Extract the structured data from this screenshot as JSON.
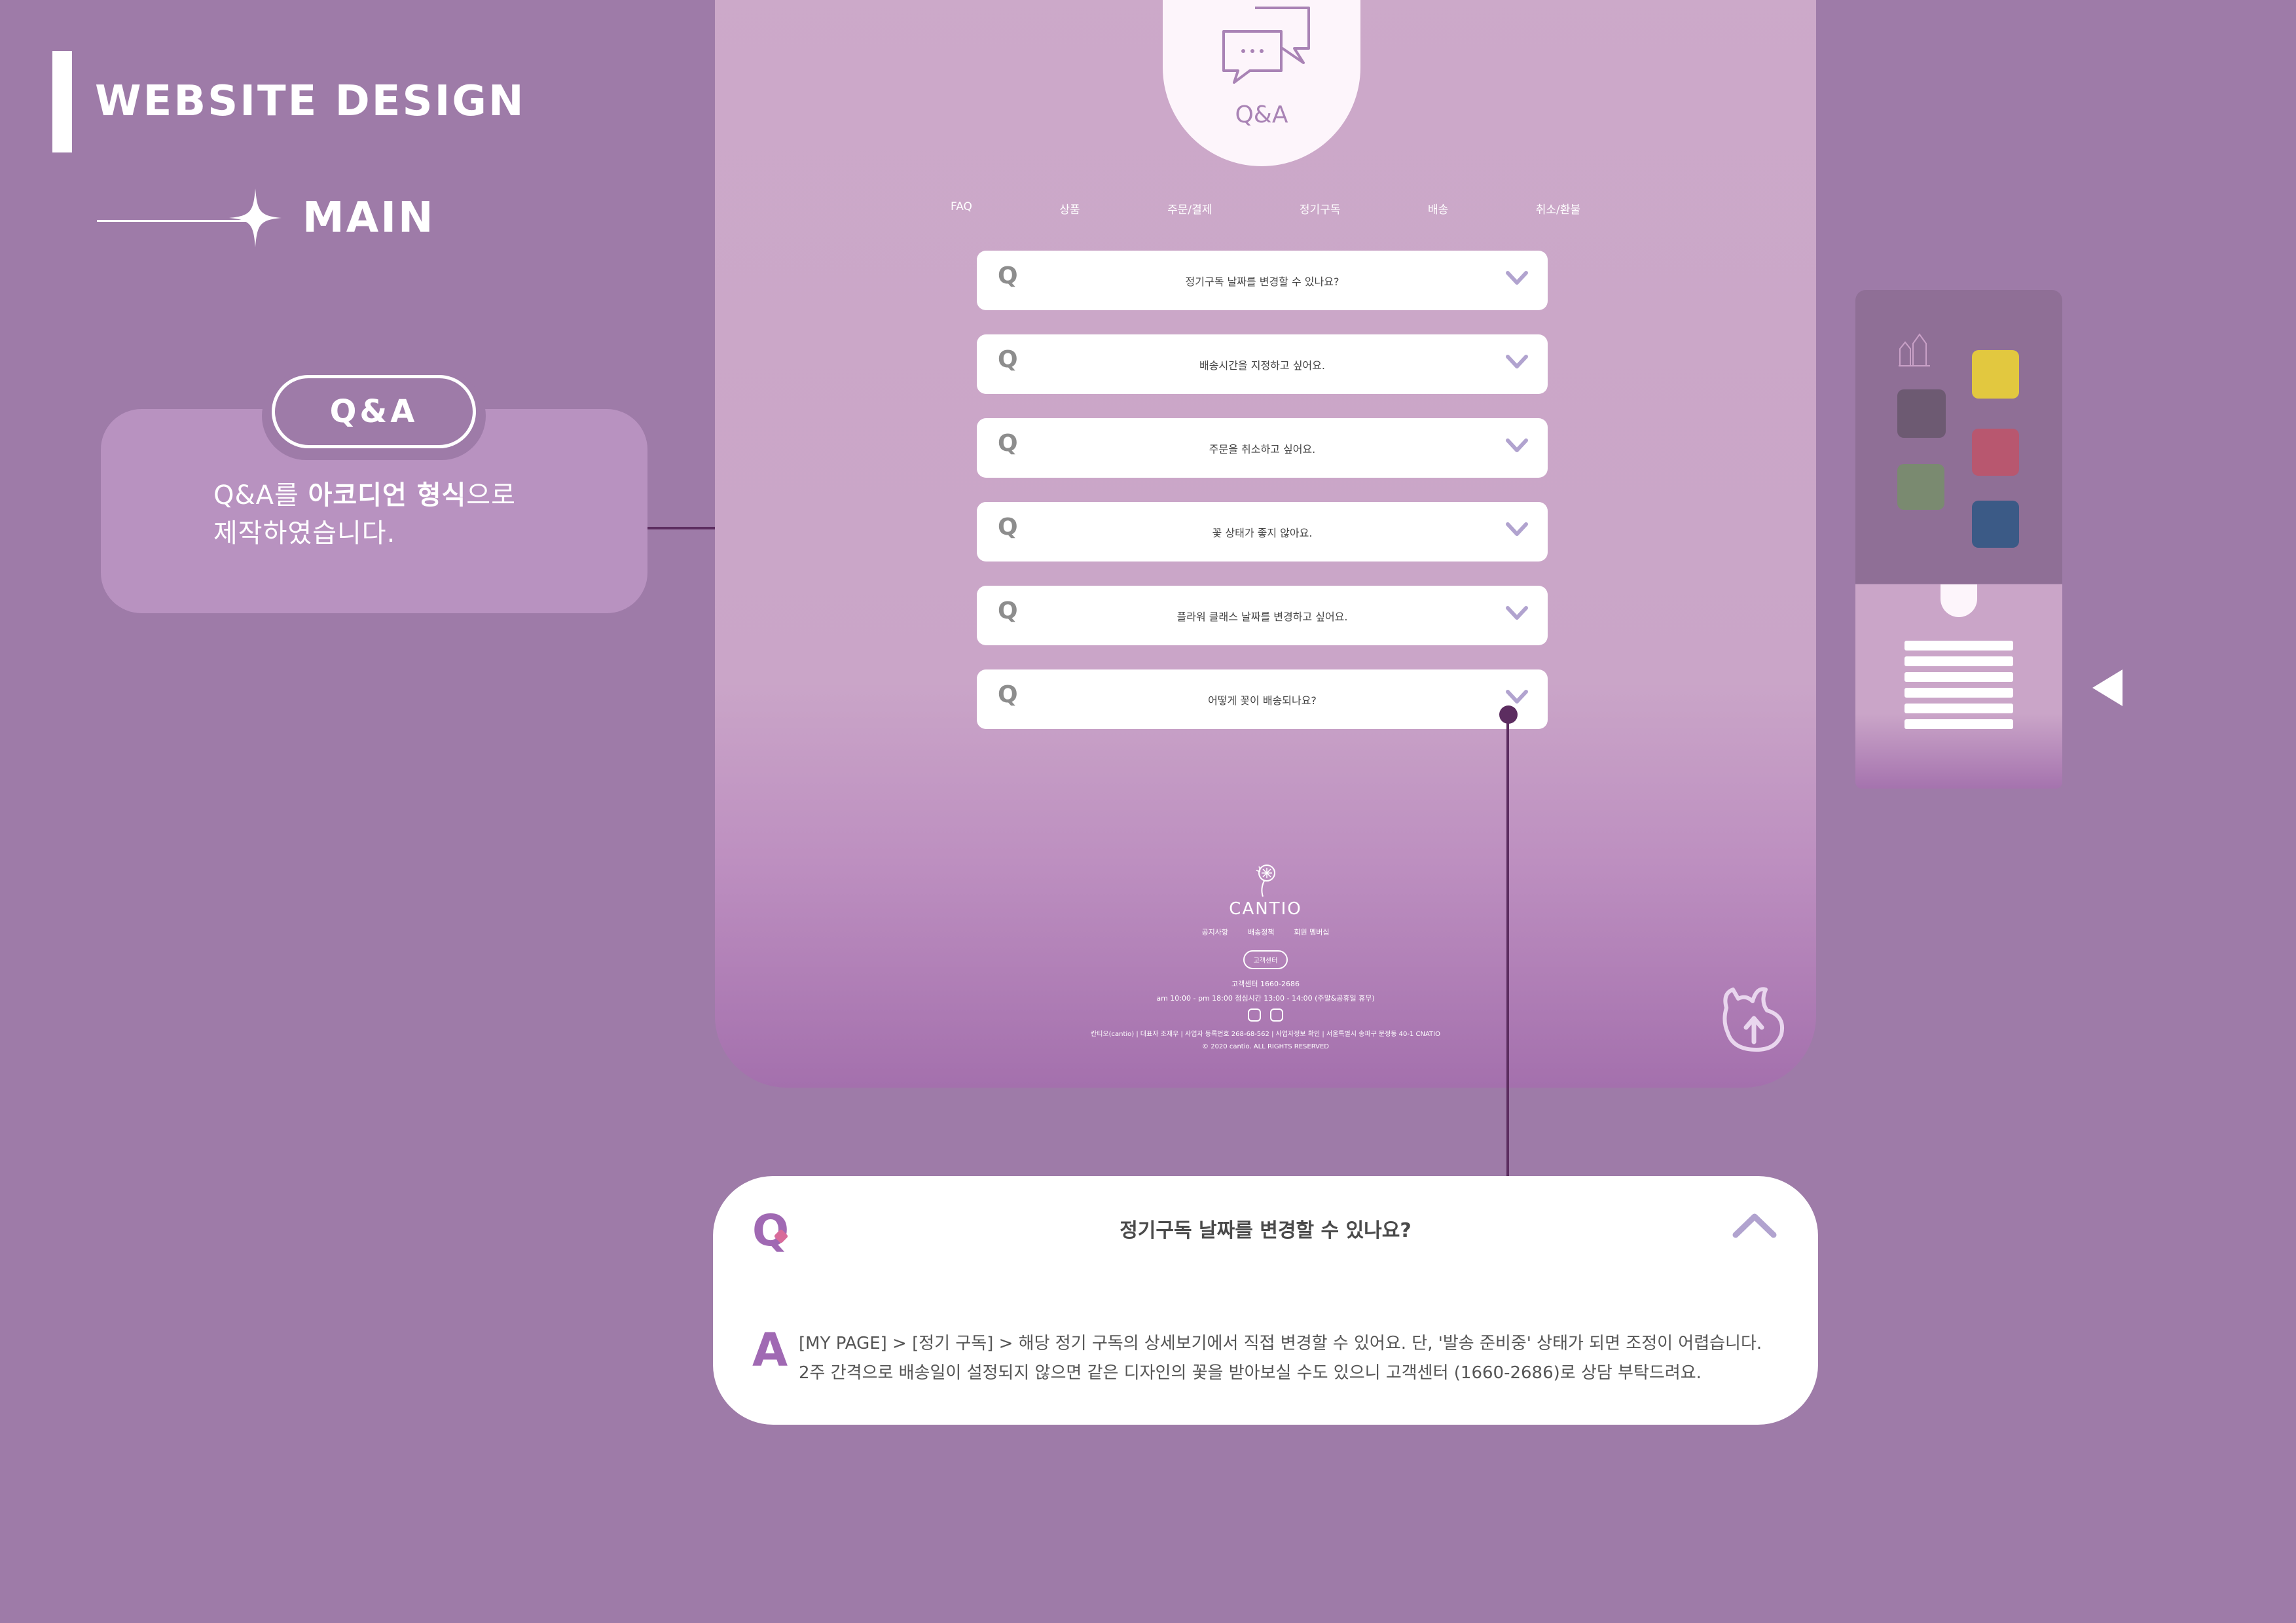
{
  "header": {
    "title": "WEBSITE DESIGN",
    "section": "MAIN"
  },
  "info_card": {
    "badge": "Q&A",
    "line1_prefix": "Q&A를 ",
    "line1_bold": "아코디언 형식",
    "line1_suffix": "으로",
    "line2": "제작하였습니다."
  },
  "mockup": {
    "tab_label": "Q&A",
    "categories": [
      "FAQ",
      "상품",
      "주문/결제",
      "정기구독",
      "배송",
      "취소/환불"
    ],
    "faq_marker": "Q",
    "faq_items": [
      "정기구독 날짜를 변경할 수 있나요?",
      "배송시간을 지정하고 싶어요.",
      "주문을 취소하고 싶어요.",
      "꽃 상태가 좋지 않아요.",
      "플라워 클래스 날짜를 변경하고 싶어요.",
      "어떻게 꽃이 배송되나요?"
    ],
    "footer": {
      "brand": "CANTIO",
      "links": [
        "공지사항",
        "배송정책",
        "회원 멤버십"
      ],
      "center_button": "고객센터",
      "tel": "고객센터 1660-2686",
      "hours": "am 10:00 - pm 18:00 점심시간 13:00 - 14:00 (주말&공휴일 휴무)",
      "biz": "칸티오(cantio) | 대표자 조재우 | 사업자 등록번호 268-68-562 | 사업자정보 확인 | 서울특별시 송파구 문정동 40-1 CNATIO",
      "copyright": "© 2020 cantio. ALL RIGHTS RESERVED"
    }
  },
  "accordion_expanded": {
    "q_marker": "Q",
    "a_marker": "A",
    "question": "정기구독 날짜를 변경할 수 있나요?",
    "answer_line1": "[MY PAGE] > [정기 구독] > 해당 정기 구독의 상세보기에서 직접 변경할 수 있어요. 단, '발송 준비중' 상태가 되면 조정이 어렵습니다.",
    "answer_line2": "2주 간격으로 배송일이 설정되지 않으면 같은 디자인의 꽃을 받아보실 수도 있으니 고객센터 (1660-2686)로 상담 부탁드려요."
  },
  "colors": {
    "background": "#9e7ba8",
    "mockup_top": "#cca9c9",
    "mockup_bottom": "#a470ad",
    "accent": "#a069b3",
    "connector": "#5c2d60",
    "chevron": "#b1a3cf"
  },
  "icons": [
    "sparkle-icon",
    "chat-bubbles-icon",
    "chevron-down-icon",
    "chevron-up-icon",
    "instagram-icon",
    "facebook-icon",
    "scroll-top-icon",
    "triangle-left-icon"
  ]
}
